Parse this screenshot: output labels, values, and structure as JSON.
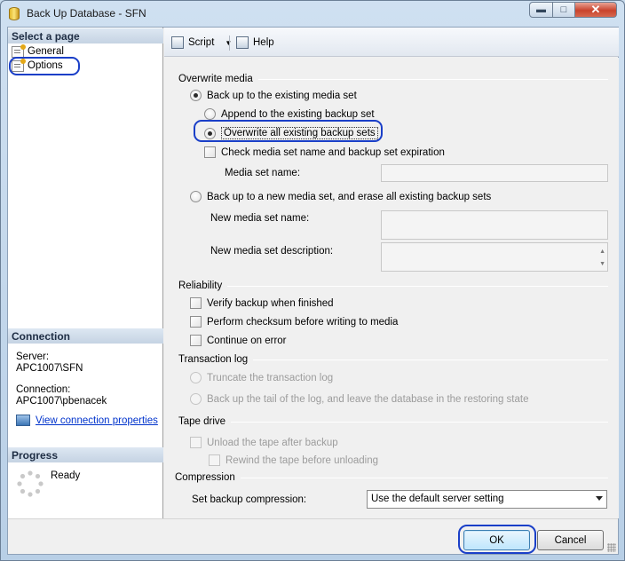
{
  "window": {
    "title": "Back Up Database - SFN",
    "controls": {
      "minimize": "▬",
      "maximize": "□",
      "close": "✕"
    }
  },
  "left": {
    "select_page_header": "Select a page",
    "pages": [
      {
        "label": "General",
        "icon": "page-wrench-icon"
      },
      {
        "label": "Options",
        "icon": "page-wrench-icon"
      }
    ],
    "connection_header": "Connection",
    "server_label": "Server:",
    "server_value": "APC1007\\SFN",
    "connection_label": "Connection:",
    "connection_value": "APC1007\\pbenacek",
    "view_connection_link": "View connection properties",
    "progress_header": "Progress",
    "progress_status": "Ready"
  },
  "toolbar": {
    "script_label": "Script",
    "help_label": "Help"
  },
  "overwrite_media": {
    "title": "Overwrite media",
    "existing_media_set": "Back up to the existing media set",
    "append_option": "Append to the existing backup set",
    "overwrite_option": "Overwrite all existing backup sets",
    "check_media_set": "Check media set name and backup set expiration",
    "media_set_name_label": "Media set name:",
    "media_set_name_value": "",
    "new_media_set": "Back up to a new media set, and erase all existing backup sets",
    "new_media_set_name_label": "New media set name:",
    "new_media_set_name_value": "",
    "new_media_set_description_label": "New media set description:",
    "new_media_set_description_value": ""
  },
  "reliability": {
    "title": "Reliability",
    "verify_backup": "Verify backup when finished",
    "perform_checksum": "Perform checksum before writing to media",
    "continue_on_error": "Continue on error"
  },
  "transaction_log": {
    "title": "Transaction log",
    "truncate": "Truncate the transaction log",
    "backup_tail": "Back up the tail of the log, and leave the database in the restoring state"
  },
  "tape_drive": {
    "title": "Tape drive",
    "unload_tape": "Unload the tape after backup",
    "rewind_tape": "Rewind the tape before unloading"
  },
  "compression": {
    "title": "Compression",
    "label": "Set backup compression:",
    "selected": "Use the default server setting"
  },
  "buttons": {
    "ok": "OK",
    "cancel": "Cancel"
  },
  "colors": {
    "highlight": "#1a3fc8",
    "link": "#0033cc"
  }
}
